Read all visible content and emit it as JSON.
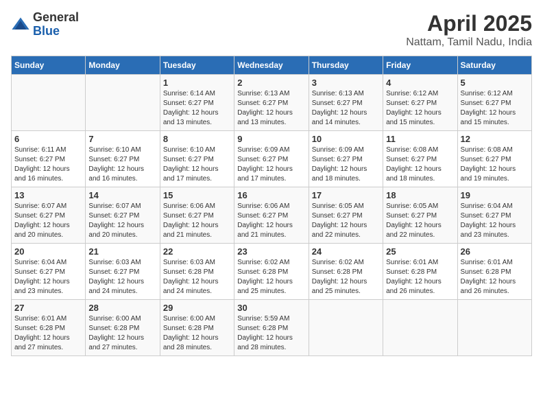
{
  "header": {
    "logo_general": "General",
    "logo_blue": "Blue",
    "title": "April 2025",
    "subtitle": "Nattam, Tamil Nadu, India"
  },
  "weekdays": [
    "Sunday",
    "Monday",
    "Tuesday",
    "Wednesday",
    "Thursday",
    "Friday",
    "Saturday"
  ],
  "weeks": [
    [
      {
        "day": "",
        "info": ""
      },
      {
        "day": "",
        "info": ""
      },
      {
        "day": "1",
        "info": "Sunrise: 6:14 AM\nSunset: 6:27 PM\nDaylight: 12 hours and 13 minutes."
      },
      {
        "day": "2",
        "info": "Sunrise: 6:13 AM\nSunset: 6:27 PM\nDaylight: 12 hours and 13 minutes."
      },
      {
        "day": "3",
        "info": "Sunrise: 6:13 AM\nSunset: 6:27 PM\nDaylight: 12 hours and 14 minutes."
      },
      {
        "day": "4",
        "info": "Sunrise: 6:12 AM\nSunset: 6:27 PM\nDaylight: 12 hours and 15 minutes."
      },
      {
        "day": "5",
        "info": "Sunrise: 6:12 AM\nSunset: 6:27 PM\nDaylight: 12 hours and 15 minutes."
      }
    ],
    [
      {
        "day": "6",
        "info": "Sunrise: 6:11 AM\nSunset: 6:27 PM\nDaylight: 12 hours and 16 minutes."
      },
      {
        "day": "7",
        "info": "Sunrise: 6:10 AM\nSunset: 6:27 PM\nDaylight: 12 hours and 16 minutes."
      },
      {
        "day": "8",
        "info": "Sunrise: 6:10 AM\nSunset: 6:27 PM\nDaylight: 12 hours and 17 minutes."
      },
      {
        "day": "9",
        "info": "Sunrise: 6:09 AM\nSunset: 6:27 PM\nDaylight: 12 hours and 17 minutes."
      },
      {
        "day": "10",
        "info": "Sunrise: 6:09 AM\nSunset: 6:27 PM\nDaylight: 12 hours and 18 minutes."
      },
      {
        "day": "11",
        "info": "Sunrise: 6:08 AM\nSunset: 6:27 PM\nDaylight: 12 hours and 18 minutes."
      },
      {
        "day": "12",
        "info": "Sunrise: 6:08 AM\nSunset: 6:27 PM\nDaylight: 12 hours and 19 minutes."
      }
    ],
    [
      {
        "day": "13",
        "info": "Sunrise: 6:07 AM\nSunset: 6:27 PM\nDaylight: 12 hours and 20 minutes."
      },
      {
        "day": "14",
        "info": "Sunrise: 6:07 AM\nSunset: 6:27 PM\nDaylight: 12 hours and 20 minutes."
      },
      {
        "day": "15",
        "info": "Sunrise: 6:06 AM\nSunset: 6:27 PM\nDaylight: 12 hours and 21 minutes."
      },
      {
        "day": "16",
        "info": "Sunrise: 6:06 AM\nSunset: 6:27 PM\nDaylight: 12 hours and 21 minutes."
      },
      {
        "day": "17",
        "info": "Sunrise: 6:05 AM\nSunset: 6:27 PM\nDaylight: 12 hours and 22 minutes."
      },
      {
        "day": "18",
        "info": "Sunrise: 6:05 AM\nSunset: 6:27 PM\nDaylight: 12 hours and 22 minutes."
      },
      {
        "day": "19",
        "info": "Sunrise: 6:04 AM\nSunset: 6:27 PM\nDaylight: 12 hours and 23 minutes."
      }
    ],
    [
      {
        "day": "20",
        "info": "Sunrise: 6:04 AM\nSunset: 6:27 PM\nDaylight: 12 hours and 23 minutes."
      },
      {
        "day": "21",
        "info": "Sunrise: 6:03 AM\nSunset: 6:27 PM\nDaylight: 12 hours and 24 minutes."
      },
      {
        "day": "22",
        "info": "Sunrise: 6:03 AM\nSunset: 6:28 PM\nDaylight: 12 hours and 24 minutes."
      },
      {
        "day": "23",
        "info": "Sunrise: 6:02 AM\nSunset: 6:28 PM\nDaylight: 12 hours and 25 minutes."
      },
      {
        "day": "24",
        "info": "Sunrise: 6:02 AM\nSunset: 6:28 PM\nDaylight: 12 hours and 25 minutes."
      },
      {
        "day": "25",
        "info": "Sunrise: 6:01 AM\nSunset: 6:28 PM\nDaylight: 12 hours and 26 minutes."
      },
      {
        "day": "26",
        "info": "Sunrise: 6:01 AM\nSunset: 6:28 PM\nDaylight: 12 hours and 26 minutes."
      }
    ],
    [
      {
        "day": "27",
        "info": "Sunrise: 6:01 AM\nSunset: 6:28 PM\nDaylight: 12 hours and 27 minutes."
      },
      {
        "day": "28",
        "info": "Sunrise: 6:00 AM\nSunset: 6:28 PM\nDaylight: 12 hours and 27 minutes."
      },
      {
        "day": "29",
        "info": "Sunrise: 6:00 AM\nSunset: 6:28 PM\nDaylight: 12 hours and 28 minutes."
      },
      {
        "day": "30",
        "info": "Sunrise: 5:59 AM\nSunset: 6:28 PM\nDaylight: 12 hours and 28 minutes."
      },
      {
        "day": "",
        "info": ""
      },
      {
        "day": "",
        "info": ""
      },
      {
        "day": "",
        "info": ""
      }
    ]
  ]
}
